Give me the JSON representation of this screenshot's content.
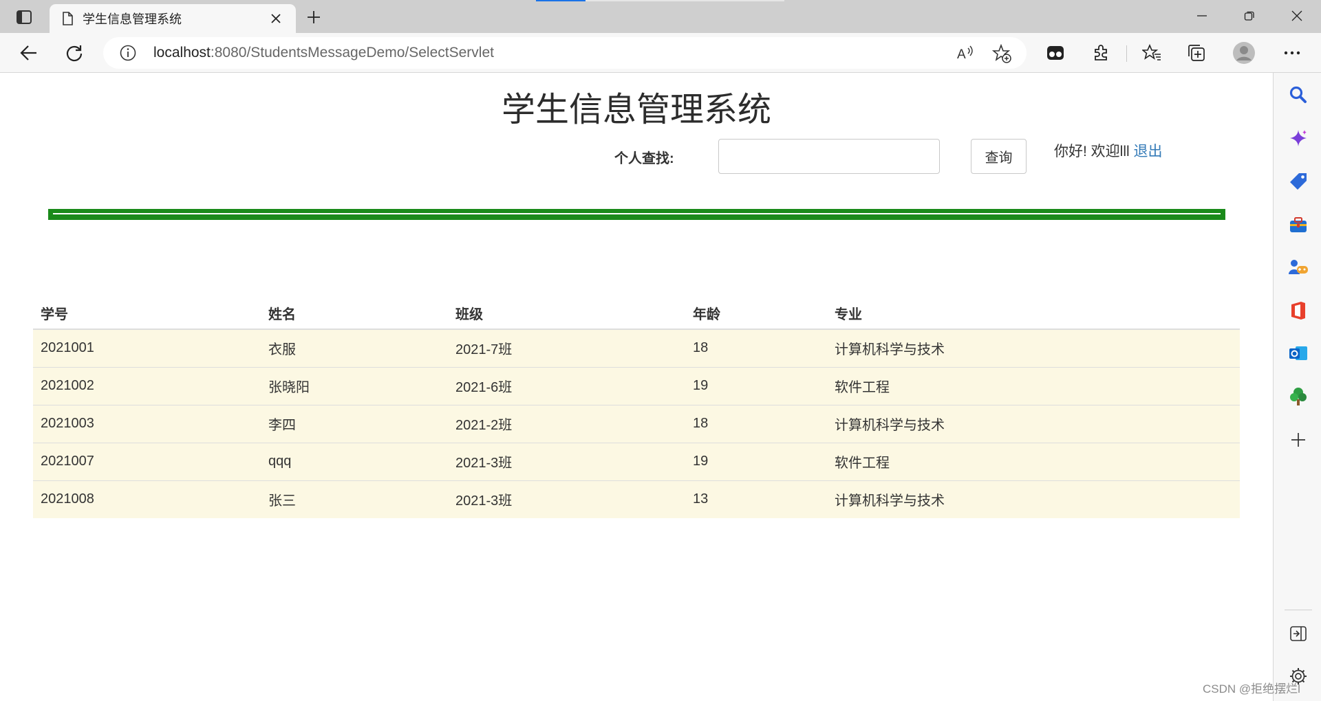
{
  "browser": {
    "tab_title": "学生信息管理系统",
    "url_host": "localhost",
    "url_rest": ":8080/StudentsMessageDemo/SelectServlet"
  },
  "page": {
    "title": "学生信息管理系统",
    "search_label": "个人查找:",
    "search_value": "",
    "search_placeholder": "",
    "search_button": "查询",
    "greeting": "你好!  欢迎lll",
    "logout": "退出"
  },
  "table": {
    "headers": [
      "学号",
      "姓名",
      "班级",
      "年龄",
      "专业"
    ],
    "rows": [
      [
        "2021001",
        "衣服",
        "2021-7班",
        "18",
        "计算机科学与技术"
      ],
      [
        "2021002",
        "张晓阳",
        "2021-6班",
        "19",
        "软件工程"
      ],
      [
        "2021003",
        "李四",
        "2021-2班",
        "18",
        "计算机科学与技术"
      ],
      [
        "2021007",
        "qqq",
        "2021-3班",
        "19",
        "软件工程"
      ],
      [
        "2021008",
        "张三",
        "2021-3班",
        "13",
        "计算机科学与技术"
      ]
    ]
  },
  "colors": {
    "divider": "#1a8a1a",
    "row_background": "#fcf8e3",
    "link": "#337ab7"
  },
  "icons": {
    "toolbar": [
      "back-arrow-icon",
      "refresh-icon",
      "info-icon",
      "read-aloud-icon",
      "add-favorite-icon",
      "tab-extension-icon",
      "extensions-puzzle-icon",
      "favorites-icon",
      "collections-icon",
      "profile-avatar-icon",
      "more-menu-icon"
    ],
    "sidebar": [
      "search-icon",
      "copilot-sparkle-icon",
      "shopping-tag-icon",
      "tools-briefcase-icon",
      "games-icon",
      "office-icon",
      "outlook-icon",
      "tree-icon",
      "add-icon",
      "hide-sidebar-icon",
      "settings-gear-icon"
    ]
  },
  "watermark": "CSDN @拒绝摆烂l"
}
